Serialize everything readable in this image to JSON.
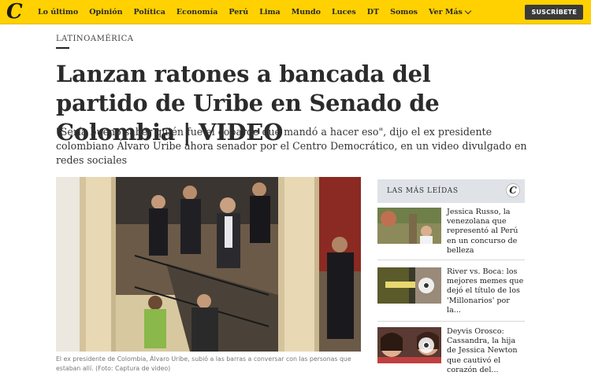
{
  "topbar": {
    "logo_glyph": "C",
    "nav": [
      "Lo último",
      "Opinión",
      "Política",
      "Economía",
      "Perú",
      "Lima",
      "Mundo",
      "Luces",
      "DT",
      "Somos",
      "Ver Más"
    ],
    "subscribe_label": "SUSCRÍBETE",
    "color": "#ffd100"
  },
  "article": {
    "section": "LATINOAMÉRICA",
    "headline": "Lanzan ratones a bancada del partido de Uribe en Senado de Colombia | VIDEO",
    "dek": "\"Sería bueno saber quién fue el cobarde que mandó a hacer eso\", dijo el ex presidente colombiano Álvaro Uribe ahora senador por el Centro Democrático, en un video divulgado en redes sociales",
    "caption": "El ex presidente de Colombia, Álvaro Uribe, subió a las barras a conversar con las personas que estaban allí. (Foto: Captura de video)"
  },
  "sidebar": {
    "title": "LAS MÁS LEÍDAS",
    "logo_glyph": "C",
    "items": [
      {
        "text": "Jessica Russo, la venezolana que representó al Perú en un concurso de belleza"
      },
      {
        "text": "River vs. Boca: los mejores memes que dejó el título de los 'Millonarios' por la..."
      },
      {
        "text": "Deyvis Orosco: Cassandra, la hija de Jessica Newton que cautivó el corazón del..."
      }
    ]
  }
}
